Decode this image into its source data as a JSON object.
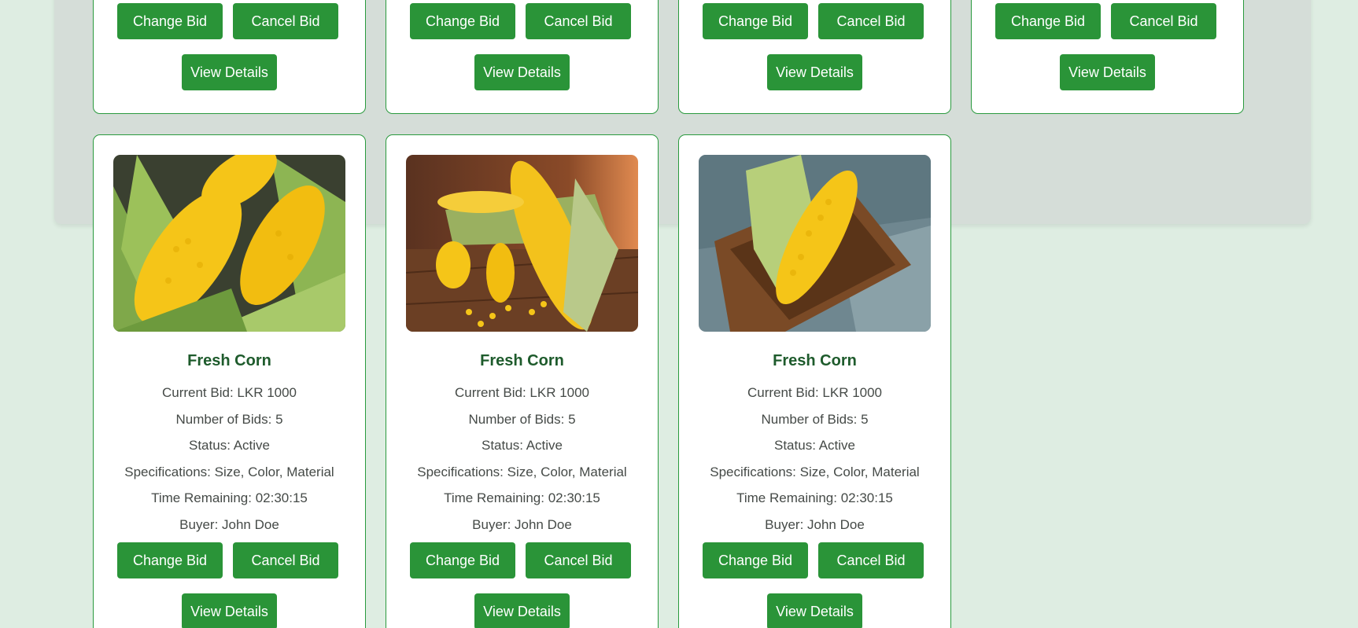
{
  "listings": {
    "top_row": [
      {
        "change_label": "Change Bid",
        "cancel_label": "Cancel Bid",
        "view_label": "View Details"
      },
      {
        "change_label": "Change Bid",
        "cancel_label": "Cancel Bid",
        "view_label": "View Details"
      },
      {
        "change_label": "Change Bid",
        "cancel_label": "Cancel Bid",
        "view_label": "View Details"
      },
      {
        "change_label": "Change Bid",
        "cancel_label": "Cancel Bid",
        "view_label": "View Details"
      }
    ],
    "bottom_row": [
      {
        "image": "corn-cobs-photo",
        "title": "Fresh Corn",
        "current_bid": "Current Bid: LKR 1000",
        "num_bids": "Number of Bids: 5",
        "status": "Status: Active",
        "specs": "Specifications: Size, Color, Material",
        "time_remaining": "Time Remaining: 02:30:15",
        "buyer": "Buyer: John Doe",
        "change_label": "Change Bid",
        "cancel_label": "Cancel Bid",
        "view_label": "View Details"
      },
      {
        "image": "corn-on-table-photo",
        "title": "Fresh Corn",
        "current_bid": "Current Bid: LKR 1000",
        "num_bids": "Number of Bids: 5",
        "status": "Status: Active",
        "specs": "Specifications: Size, Color, Material",
        "time_remaining": "Time Remaining: 02:30:15",
        "buyer": "Buyer: John Doe",
        "change_label": "Change Bid",
        "cancel_label": "Cancel Bid",
        "view_label": "View Details"
      },
      {
        "image": "corn-in-wooden-box-photo",
        "title": "Fresh Corn",
        "current_bid": "Current Bid: LKR 1000",
        "num_bids": "Number of Bids: 5",
        "status": "Status: Active",
        "specs": "Specifications: Size, Color, Material",
        "time_remaining": "Time Remaining: 02:30:15",
        "buyer": "Buyer: John Doe",
        "change_label": "Change Bid",
        "cancel_label": "Cancel Bid",
        "view_label": "View Details"
      }
    ]
  },
  "colors": {
    "page_background": "#deede2",
    "panel_background": "#d5ddd8",
    "card_border": "#2a9a3e",
    "button": "#2a9438",
    "title": "#1e5b2c",
    "body_text": "#454a47"
  }
}
